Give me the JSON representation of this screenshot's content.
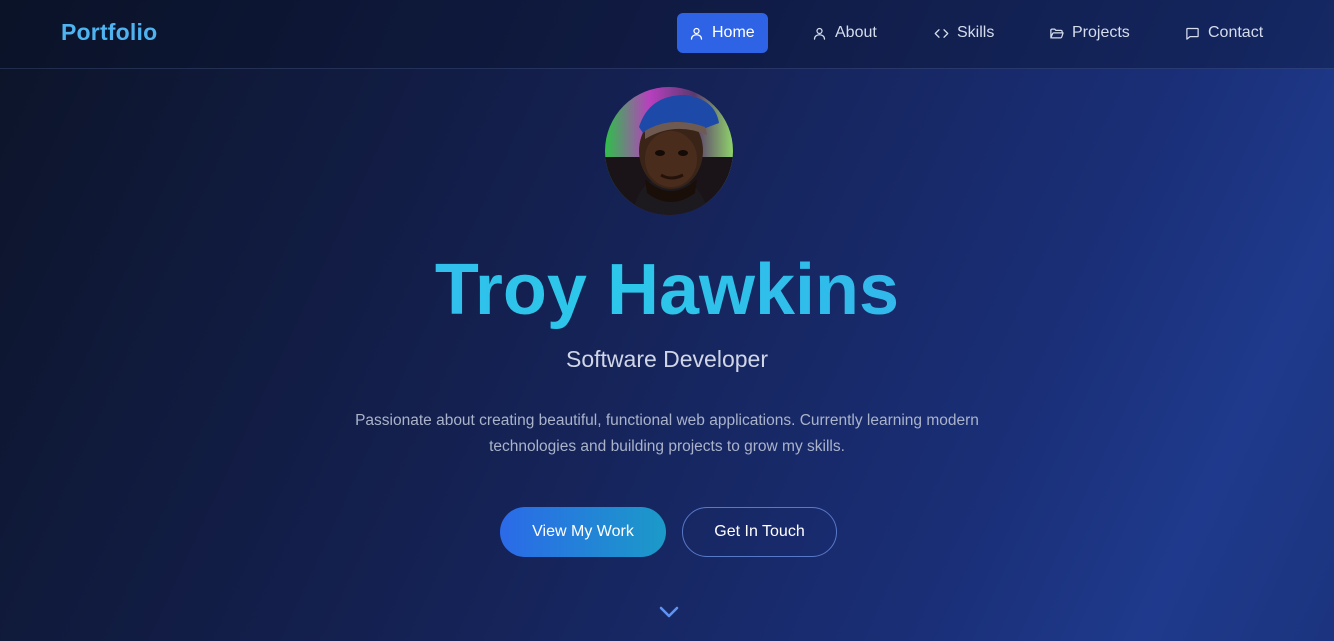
{
  "nav": {
    "brand": "Portfolio",
    "items": [
      {
        "label": "Home",
        "icon": "user-icon",
        "active": true
      },
      {
        "label": "About",
        "icon": "user-icon",
        "active": false
      },
      {
        "label": "Skills",
        "icon": "code-icon",
        "active": false
      },
      {
        "label": "Projects",
        "icon": "folder-icon",
        "active": false
      },
      {
        "label": "Contact",
        "icon": "message-icon",
        "active": false
      }
    ]
  },
  "hero": {
    "avatar_icon": "profile-photo",
    "name": "Troy Hawkins",
    "role": "Software Developer",
    "description": "Passionate about creating beautiful, functional web applications. Currently learning modern technologies and building projects to grow my skills.",
    "primary_button": "View My Work",
    "secondary_button": "Get In Touch",
    "scroll_icon": "chevron-down-icon"
  },
  "colors": {
    "accent": "#2e63e6",
    "brand_text": "#4fb3f0",
    "name_gradient_start": "#3aa8ee",
    "name_gradient_mid": "#2cc8ea"
  }
}
